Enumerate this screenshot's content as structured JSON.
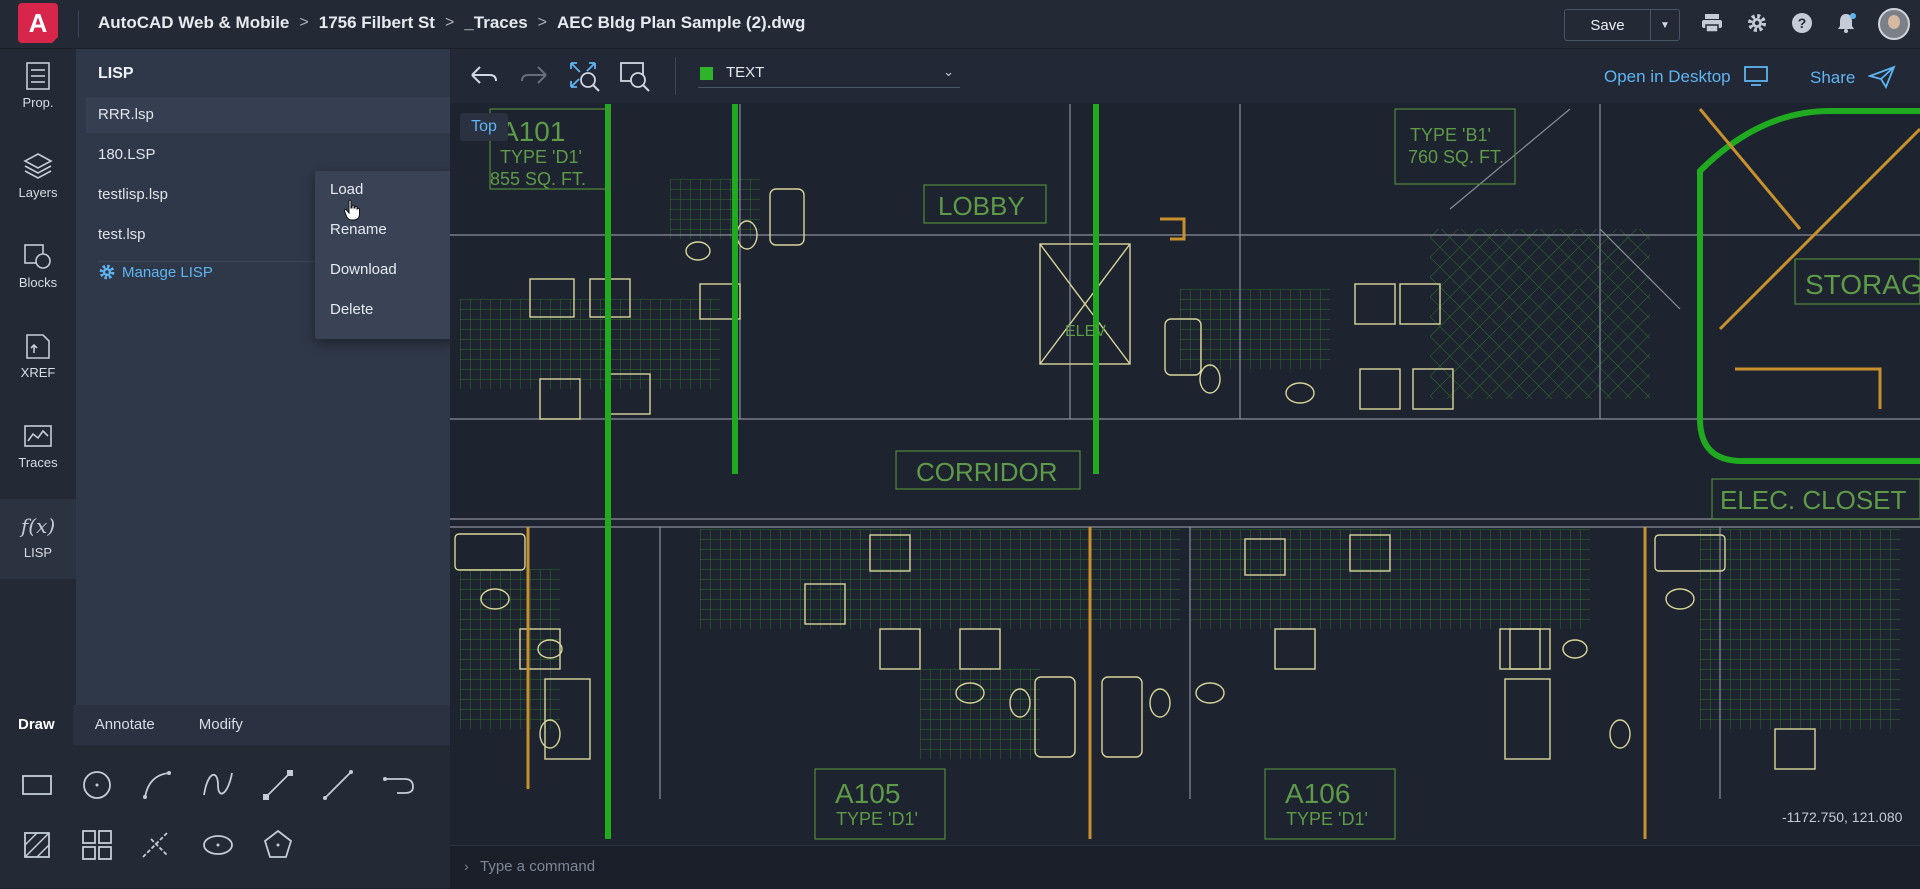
{
  "app": {
    "logo_letter": "A",
    "breadcrumbs": [
      "AutoCAD Web & Mobile",
      "1756 Filbert St",
      "_Traces",
      "AEC Bldg Plan Sample (2).dwg"
    ],
    "breadcrumb_separator": ">"
  },
  "toolbar": {
    "save_label": "Save",
    "icons": [
      "print-icon",
      "gear-icon",
      "help-icon",
      "bell-icon",
      "avatar"
    ]
  },
  "rail": {
    "items": [
      {
        "label": "Prop.",
        "icon": "properties-icon"
      },
      {
        "label": "Layers",
        "icon": "layers-icon"
      },
      {
        "label": "Blocks",
        "icon": "blocks-icon"
      },
      {
        "label": "XREF",
        "icon": "xref-icon"
      },
      {
        "label": "Traces",
        "icon": "traces-icon"
      },
      {
        "label": "LISP",
        "icon": "function-icon",
        "display": "f(x)",
        "active": true
      }
    ]
  },
  "lisp_panel": {
    "title": "LISP",
    "files": [
      "RRR.lsp",
      "180.LSP",
      "testlisp.lsp",
      "test.lsp"
    ],
    "manage_label": "Manage LISP",
    "context_menu": [
      "Load",
      "Rename",
      "Download",
      "Delete"
    ]
  },
  "drawbar": {
    "tabs": [
      "Draw",
      "Annotate",
      "Modify"
    ],
    "active_tab": "Draw",
    "tools": [
      "rectangle-tool",
      "circle-tool",
      "arc-tool",
      "spline-tool",
      "polyline-tool",
      "line-tool",
      "offset-tool",
      "hatch-tool",
      "array-tool",
      "trim-tool",
      "ellipse-tool",
      "polygon-tool"
    ]
  },
  "canvas": {
    "layer_name": "TEXT",
    "layer_color": "#2fb32b",
    "open_desktop_label": "Open in Desktop",
    "share_label": "Share",
    "view_label": "Top",
    "coordinates": "-1172.750, 121.080",
    "room_labels": [
      "A101",
      "TYPE 'D1'",
      "855 SQ. FT.",
      "LOBBY",
      "CORRIDOR",
      "TYPE 'B1'",
      "760 SQ. FT.",
      "STORAGE",
      "ELEC. CLOSET",
      "A105",
      "A106",
      "ELEV"
    ],
    "accent_color": "#5fb5f2"
  },
  "command_line": {
    "placeholder": "Type a command"
  }
}
